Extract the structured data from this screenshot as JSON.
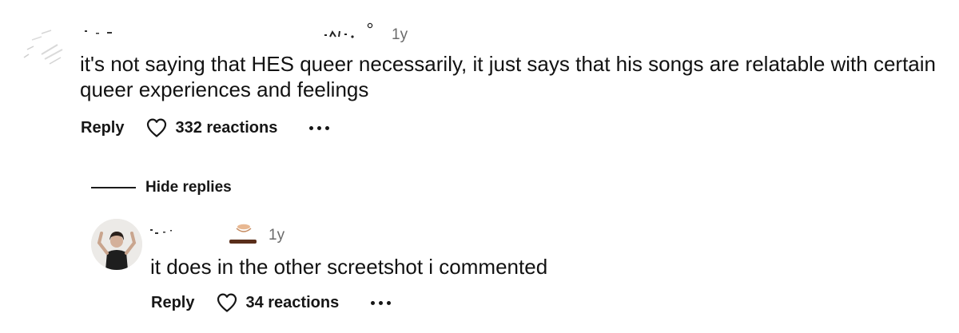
{
  "comment": {
    "timestamp": "1y",
    "text": "it's not saying that HES queer necessarily, it just says that his songs are relatable with certain queer experiences and feelings",
    "reply_label": "Reply",
    "reactions_label": "332 reactions",
    "like_icon": "heart-outline-icon",
    "more_icon": "more-horizontal-icon"
  },
  "thread": {
    "hide_replies_label": "Hide replies"
  },
  "reply": {
    "timestamp": "1y",
    "text": "it does in the other screetshot i commented",
    "reply_label": "Reply",
    "reactions_label": "34 reactions",
    "like_icon": "heart-outline-icon",
    "more_icon": "more-horizontal-icon"
  }
}
